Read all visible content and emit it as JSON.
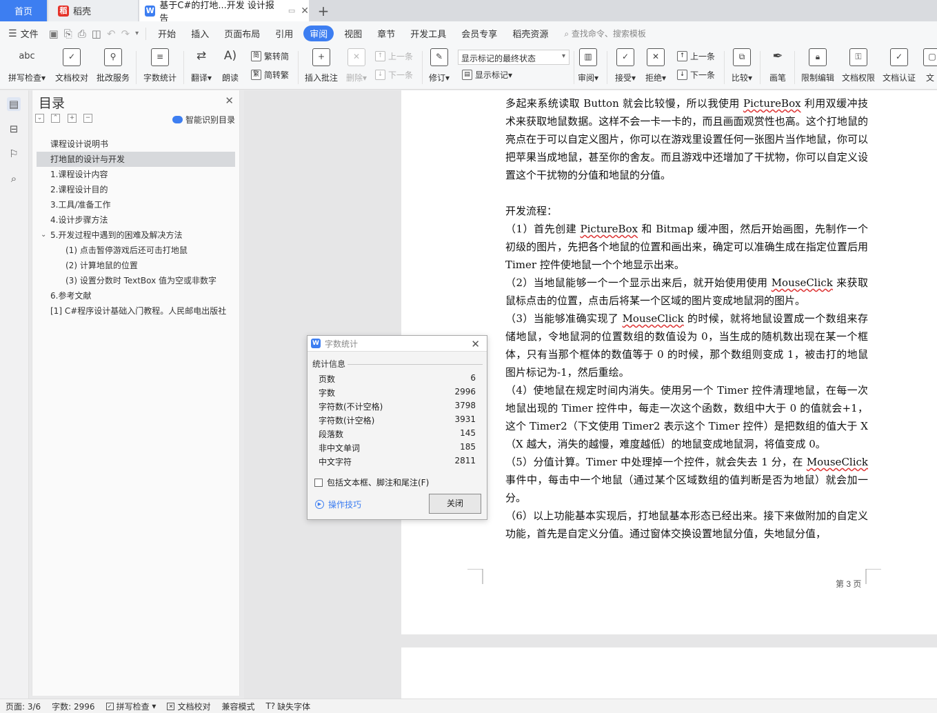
{
  "tabs": {
    "home": "首页",
    "daoke": "稻壳",
    "doc": "基于C#的打地...开发 设计报告"
  },
  "menu": {
    "file": "文件",
    "items": [
      "开始",
      "插入",
      "页面布局",
      "引用",
      "审阅",
      "视图",
      "章节",
      "开发工具",
      "会员专享",
      "稻壳资源"
    ],
    "active": "审阅",
    "search_placeholder": "查找命令、搜索模板"
  },
  "ribbon": {
    "spell_check": "拼写检查",
    "doc_proof": "文档校对",
    "batch_service": "批改服务",
    "word_count": "字数统计",
    "translate": "翻译",
    "read_aloud": "朗读",
    "to_traditional": "繁转简",
    "to_simplified": "简转繁",
    "insert_comment": "插入批注",
    "delete": "删除",
    "prev": "上一条",
    "next": "下一条",
    "revise": "修订",
    "markup_state": "显示标记的最终状态",
    "show_markup": "显示标记",
    "review": "审阅",
    "accept": "接受",
    "reject": "拒绝",
    "prev2": "上一条",
    "next2": "下一条",
    "compare": "比较",
    "pen": "画笔",
    "restrict_edit": "限制编辑",
    "doc_rights": "文档权限",
    "doc_cert": "文档认证",
    "doc_more": "文"
  },
  "nav": {
    "title": "目录",
    "smart_toc": "智能识别目录",
    "items": [
      {
        "text": "课程设计说明书",
        "level": 1,
        "selected": false
      },
      {
        "text": "打地鼠的设计与开发",
        "level": 1,
        "selected": true
      },
      {
        "text": "1.课程设计内容",
        "level": 1,
        "selected": false
      },
      {
        "text": "2.课程设计目的",
        "level": 1,
        "selected": false
      },
      {
        "text": "3.工具/准备工作",
        "level": 1,
        "selected": false
      },
      {
        "text": "4.设计步骤方法",
        "level": 1,
        "selected": false
      },
      {
        "text": "5.开发过程中遇到的困难及解决方法",
        "level": 1,
        "selected": false,
        "expanded": true
      },
      {
        "text": "(1) 点击暂停游戏后还可击打地鼠",
        "level": 2,
        "selected": false
      },
      {
        "text": "(2) 计算地鼠的位置",
        "level": 2,
        "selected": false
      },
      {
        "text": "(3) 设置分数时 TextBox 值为空或非数字",
        "level": 2,
        "selected": false
      },
      {
        "text": "6.参考文献",
        "level": 1,
        "selected": false
      },
      {
        "text": "[1] C#程序设计基础入门教程。人民邮电出版社",
        "level": 1,
        "selected": false
      }
    ]
  },
  "document": {
    "paragraphs": [
      [
        {
          "t": "多起来系统读取 Button 就会比较慢，所以我使用 "
        },
        {
          "t": "PictureBox",
          "w": true
        },
        {
          "t": " 利用双缓冲技术来获取地鼠数据。这样不会一卡一卡的，而且画面观赏性也高。这个打地鼠的亮点在于可以自定义图片，你可以在游戏里设置任何一张图片当作地鼠，你可以把苹果当成地鼠，甚至你的舍友。而且游戏中还增加了干扰物，你可以自定义设置这个干扰物的分值和地鼠的分值。"
        }
      ],
      [
        {
          "t": " "
        }
      ],
      [
        {
          "t": "开发流程："
        }
      ],
      [
        {
          "t": "（1）首先创建 "
        },
        {
          "t": "PictureBox",
          "w": true
        },
        {
          "t": " 和 Bitmap 缓冲图，然后开始画图，先制作一个初级的图片，先把各个地鼠的位置和画出来，确定可以准确生成在指定位置后用 Timer 控件使地鼠一个个地显示出来。"
        }
      ],
      [
        {
          "t": "（2）当地鼠能够一个一个显示出来后，就开始使用使用 "
        },
        {
          "t": "MouseClick",
          "w": true
        },
        {
          "t": " 来获取鼠标点击的位置，点击后将某一个区域的图片变成地鼠洞的图片。"
        }
      ],
      [
        {
          "t": "（3）当能够准确实现了 "
        },
        {
          "t": "MouseClick",
          "w": true
        },
        {
          "t": " 的时候，就将地鼠设置成一个数组来存储地鼠，令地鼠洞的位置数组的数值设为 0，当生成的随机数出现在某一个框体，只有当那个框体的数值等于 0 的时候，那个数组则变成 1，被击打的地鼠图片标记为-1，然后重绘。"
        }
      ],
      [
        {
          "t": "（4）使地鼠在规定时间内消失。使用另一个 Timer 控件清理地鼠，在每一次地鼠出现的 Timer 控件中，每走一次这个函数，数组中大于 0 的值就会+1，这个 Timer2（下文使用 Timer2 表示这个 Timer 控件）是把数组的值大于 X（X 越大，消失的越慢，难度越低）的地鼠变成地鼠洞，将值变成 0。"
        }
      ],
      [
        {
          "t": "（5）分值计算。Timer 中处理掉一个控件，就会失去 1 分，在 "
        },
        {
          "t": "MouseClick",
          "w": true
        },
        {
          "t": " 事件中，每击中一个地鼠（通过某个区域数组的值判断是否为地鼠）就会加一分。"
        }
      ],
      [
        {
          "t": "（6）以上功能基本实现后，打地鼠基本形态已经出来。接下来做附加的自定义功能，首先是自定义分值。通过窗体交换设置地鼠分值，失地鼠分值，"
        }
      ]
    ],
    "page_footer": "第 3 页"
  },
  "dialog": {
    "title": "字数统计",
    "section": "统计信息",
    "rows": [
      {
        "label": "页数",
        "value": "6"
      },
      {
        "label": "字数",
        "value": "2996"
      },
      {
        "label": "字符数(不计空格)",
        "value": "3798"
      },
      {
        "label": "字符数(计空格)",
        "value": "3931"
      },
      {
        "label": "段落数",
        "value": "145"
      },
      {
        "label": "非中文单词",
        "value": "185"
      },
      {
        "label": "中文字符",
        "value": "2811"
      }
    ],
    "checkbox_label": "包括文本框、脚注和尾注(F)",
    "tips": "操作技巧",
    "close": "关闭"
  },
  "status": {
    "page": "页面: 3/6",
    "words": "字数: 2996",
    "spell": "拼写检查",
    "proof": "文档校对",
    "compat": "兼容模式",
    "missing_font": "缺失字体"
  },
  "colors": {
    "accent": "#3d7ef1",
    "spell_error": "#dd3333"
  }
}
